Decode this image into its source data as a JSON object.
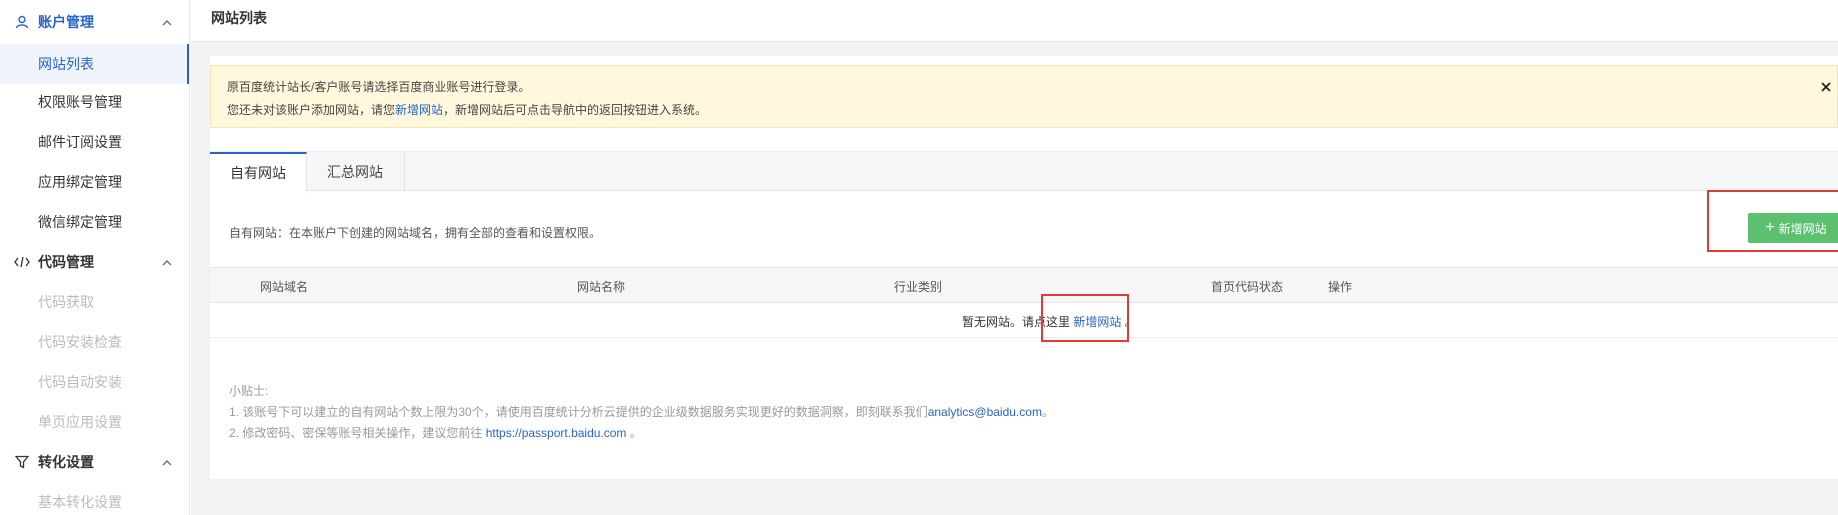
{
  "sidebar": {
    "groups": [
      {
        "label": "账户管理",
        "icon": "user-icon",
        "items": [
          "网站列表",
          "权限账号管理",
          "邮件订阅设置",
          "应用绑定管理",
          "微信绑定管理"
        ]
      },
      {
        "label": "代码管理",
        "icon": "code-icon",
        "items": [
          "代码获取",
          "代码安装检查",
          "代码自动安装",
          "单页应用设置"
        ]
      },
      {
        "label": "转化设置",
        "icon": "filter-icon",
        "items": [
          "基本转化设置"
        ]
      }
    ],
    "selected_item": "网站列表"
  },
  "header": {
    "title": "网站列表"
  },
  "notice": {
    "line1": "原百度统计站长/客户账号请选择百度商业账号进行登录。",
    "line2_before": "您还未对该账户添加网站，请您",
    "line2_link": "新增网站",
    "line2_after": "，新增网站后可点击导航中的返回按钮进入系统。"
  },
  "tabs": [
    "自有网站",
    "汇总网站"
  ],
  "description": "自有网站：在本账户下创建的网站域名，拥有全部的查看和设置权限。",
  "add_button": "新增网站",
  "table": {
    "columns": [
      "网站域名",
      "网站名称",
      "行业类别",
      "首页代码状态",
      "操作"
    ],
    "empty_before": "暂无网站。请点这里",
    "empty_link": "新增网站",
    "empty_after": "。"
  },
  "tips": {
    "title": "小贴士:",
    "tip1_before": "1. 该账号下可以建立的自有网站个数上限为30个，请使用百度统计分析云提供的企业级数据服务实现更好的数据洞察，即刻联系我们",
    "tip1_link": "analytics@baidu.com",
    "tip1_after": "。",
    "tip2_before": "2. 修改密码、密保等账号相关操作，建议您前往 ",
    "tip2_link": "https://passport.baidu.com",
    "tip2_after": " 。"
  },
  "colors": {
    "accent": "#2a62c9",
    "add_button": "#5bc16f",
    "notice_bg": "#fff8dc",
    "highlight": "#e53935"
  }
}
